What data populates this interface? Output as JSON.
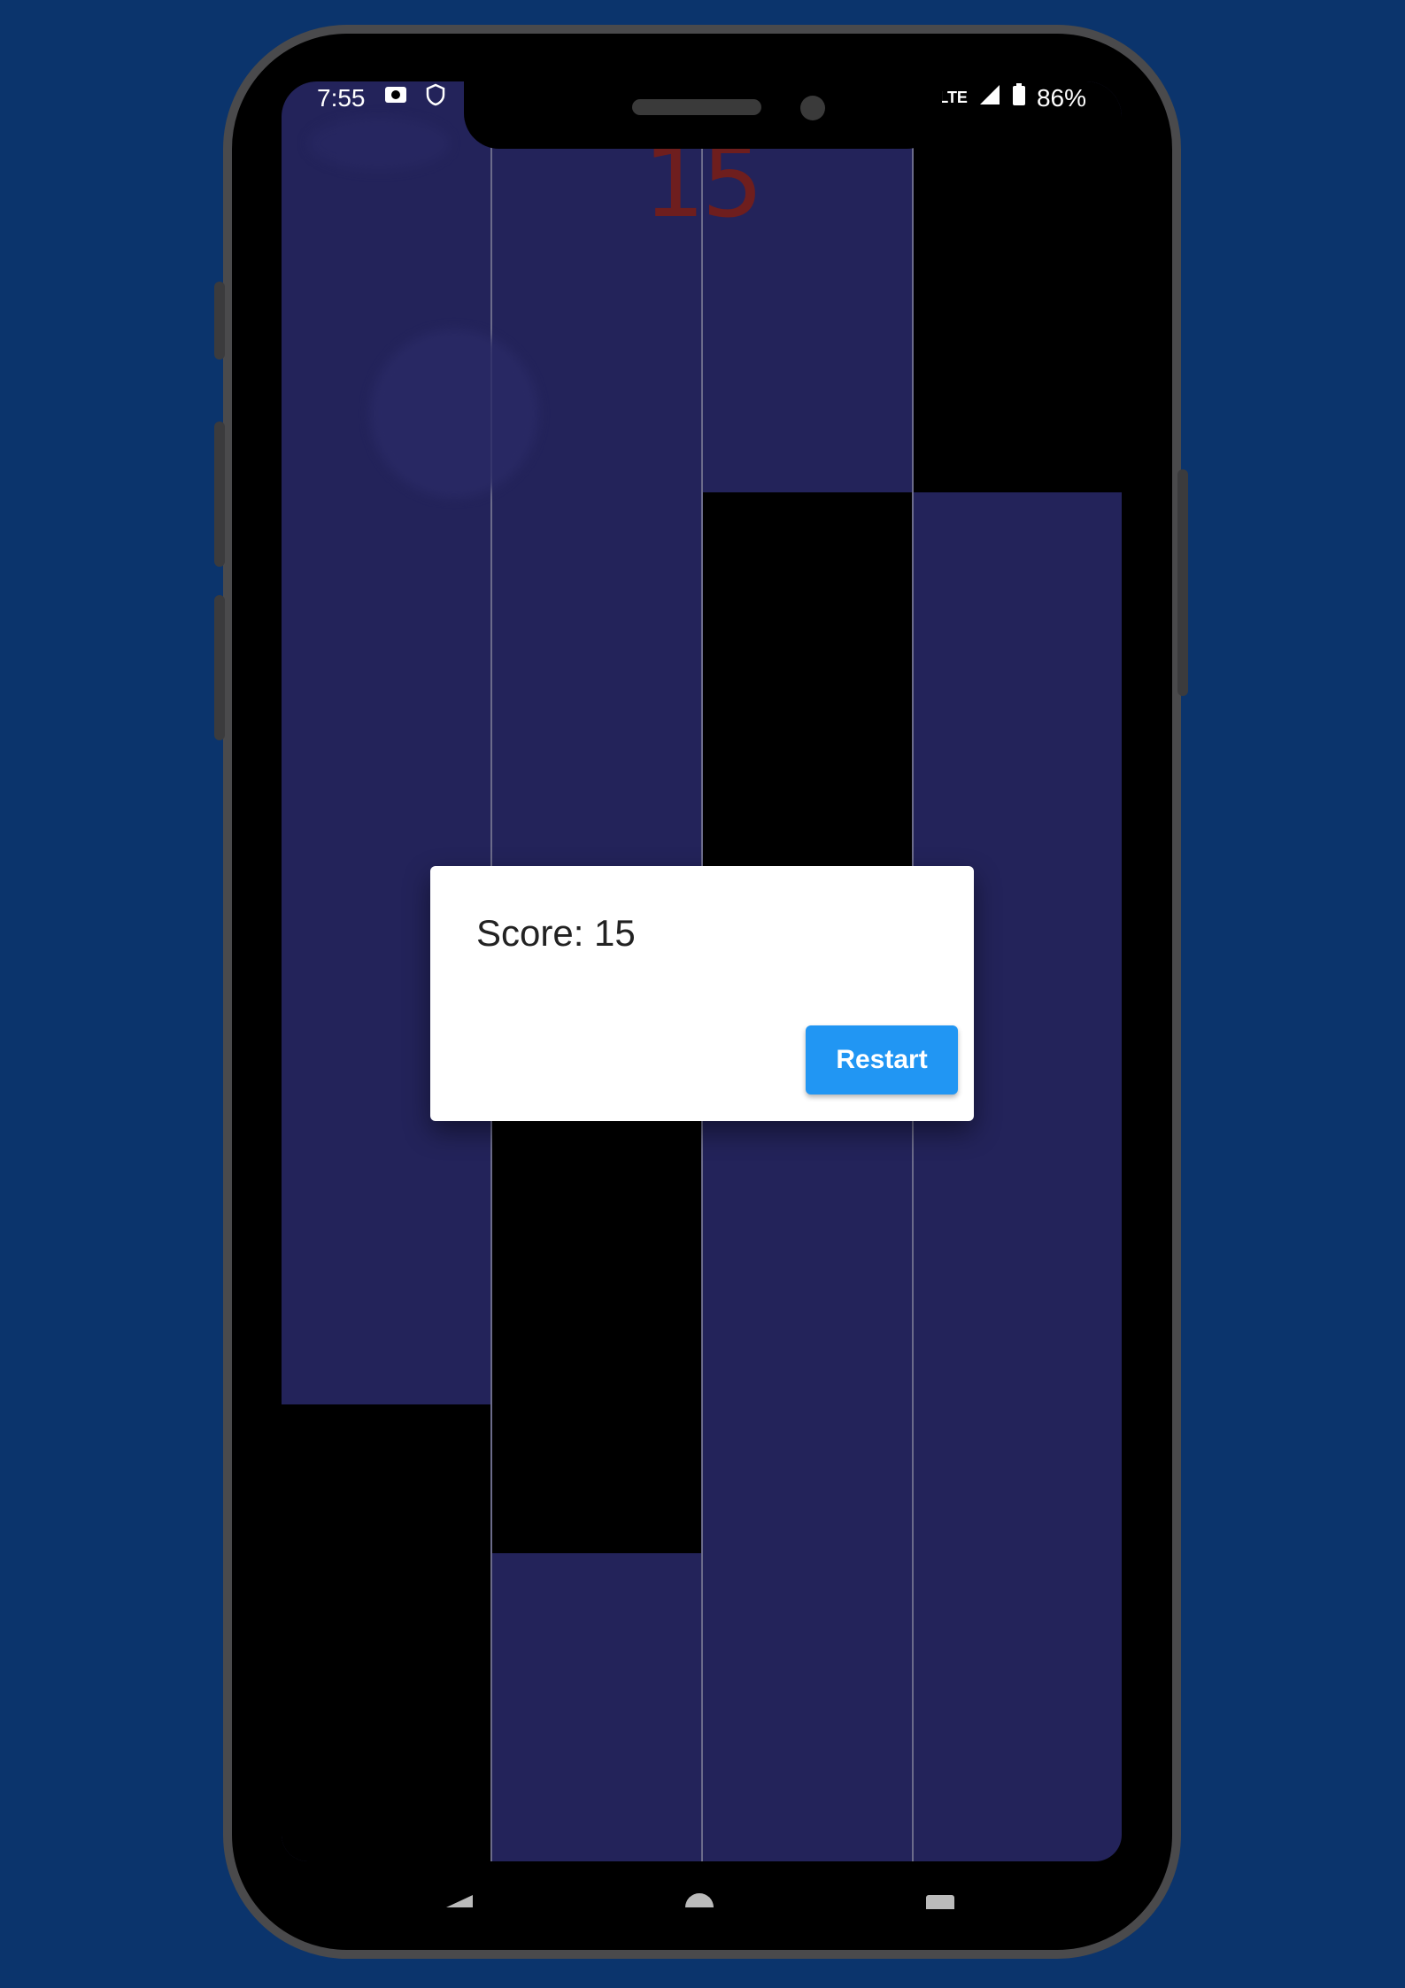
{
  "status_bar": {
    "time": "7:55",
    "battery": "86%",
    "icons": [
      "photo-notification-icon",
      "shield-notification-icon",
      "lte-icon",
      "signal-icon",
      "battery-icon"
    ]
  },
  "game": {
    "score_display": "15",
    "lanes": 4,
    "colors": {
      "background": "#23235a",
      "tile": "#000000",
      "score": "#6e1e1e"
    }
  },
  "dialog": {
    "score_text": "Score: 15",
    "restart_label": "Restart",
    "button_color": "#2196f3"
  },
  "navigation": {
    "icons": [
      "back-icon",
      "home-icon",
      "recents-icon"
    ]
  },
  "device": {
    "frame_color": "#4a4a4c",
    "page_background": "#0b346c"
  }
}
